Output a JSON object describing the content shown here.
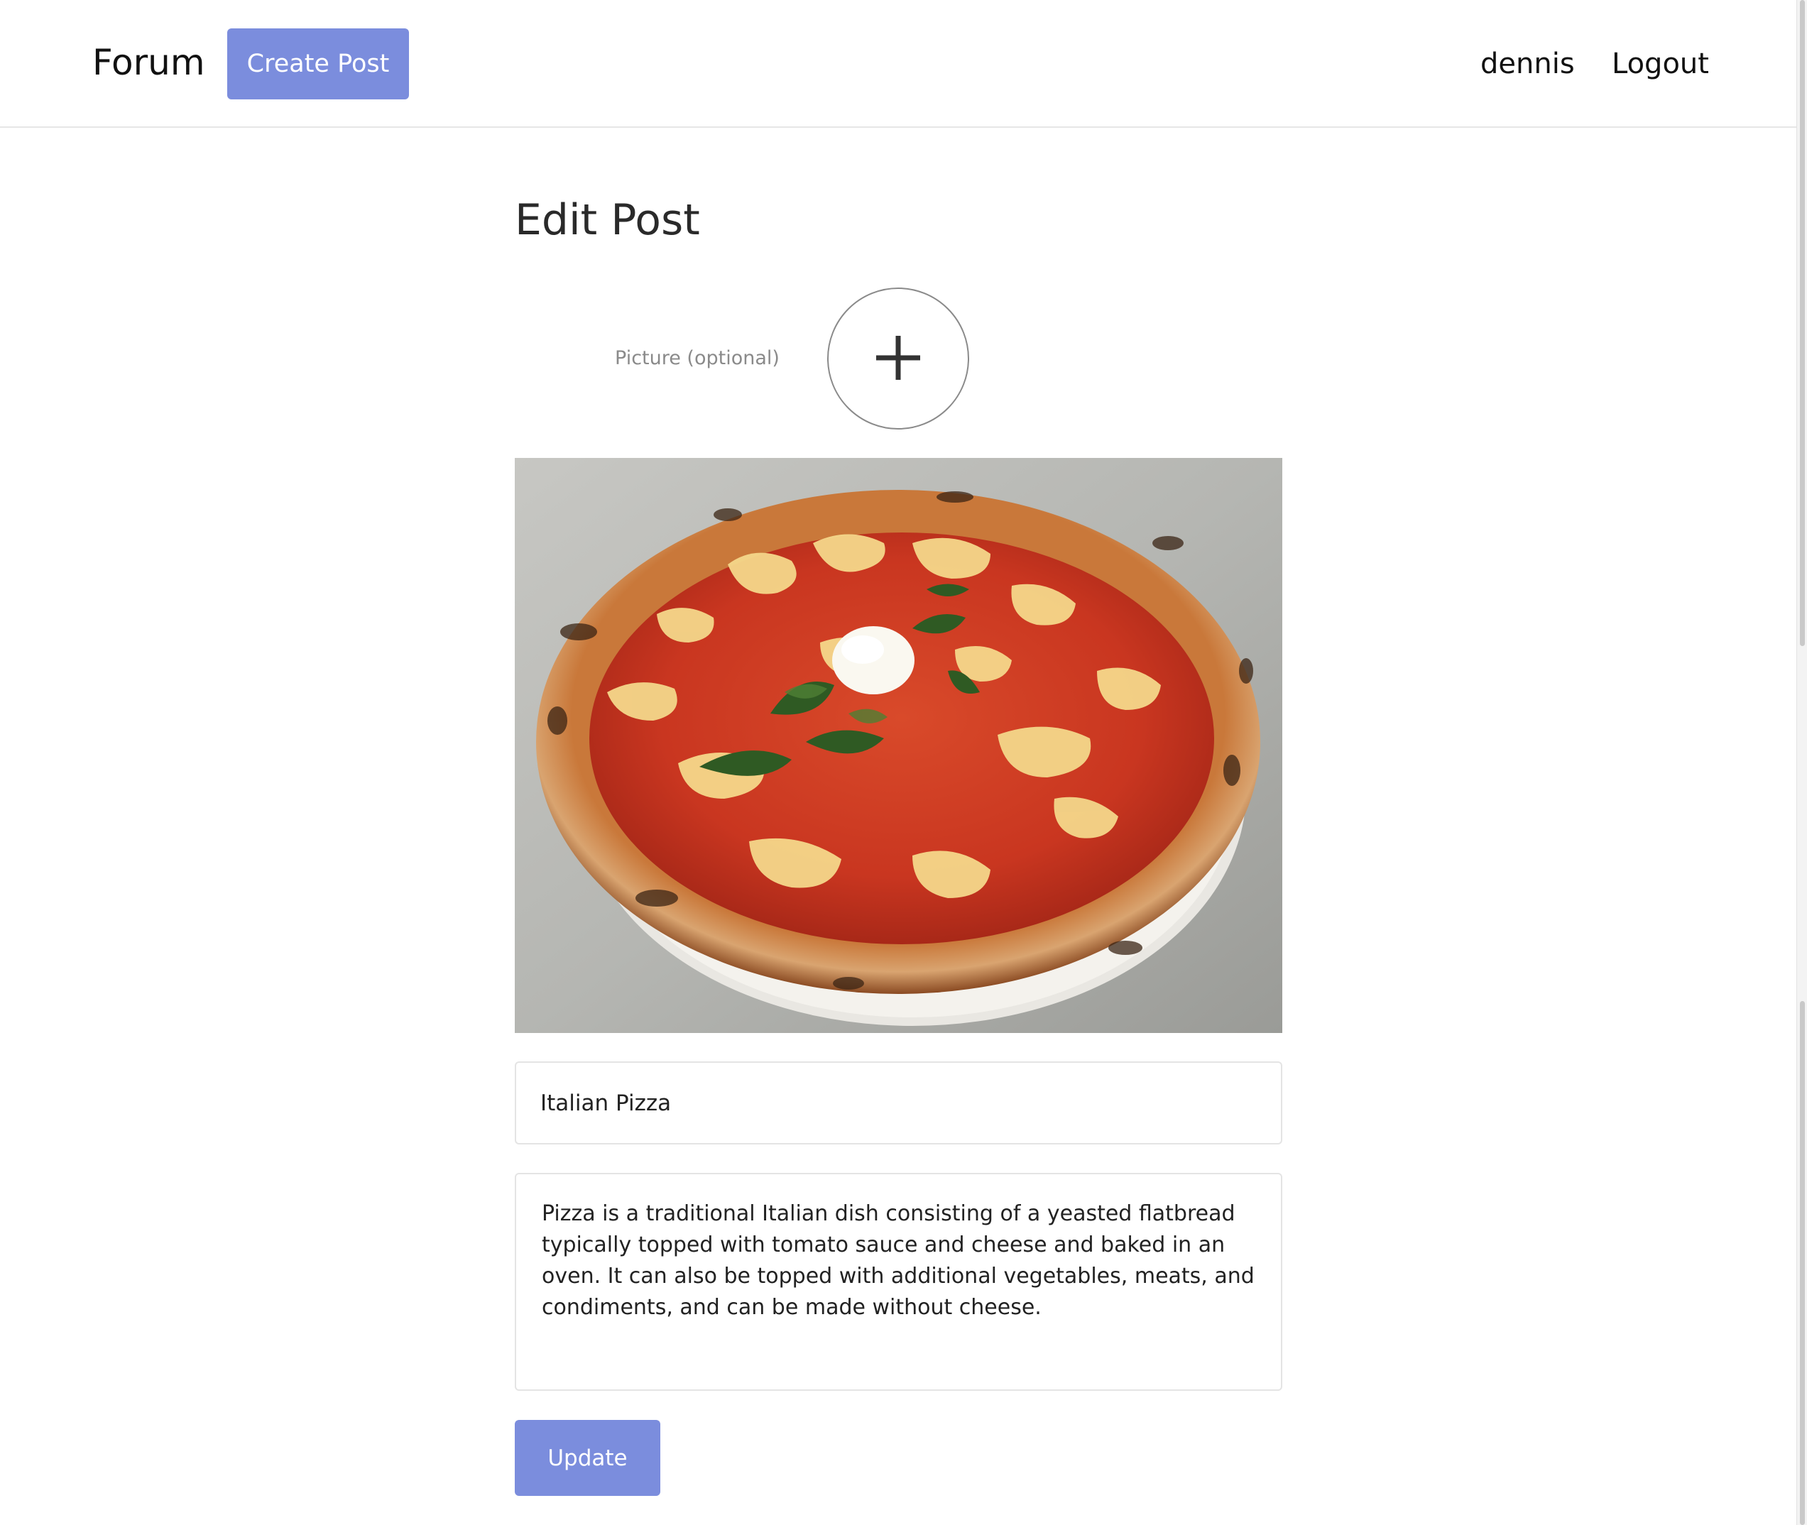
{
  "navbar": {
    "brand": "Forum",
    "create_post_label": "Create Post",
    "username": "dennis",
    "logout_label": "Logout",
    "accent_color": "#7b8ddd"
  },
  "form": {
    "heading": "Edit Post",
    "picture_label": "Picture (optional)",
    "picture_button_icon": "plus-icon",
    "image_subject": "pizza margherita photo",
    "title_value": "Italian Pizza",
    "body_value": "Pizza is a traditional Italian dish consisting of a yeasted flatbread typically topped with tomato sauce and cheese and baked in an oven. It can also be topped with additional vegetables, meats, and condiments, and can be made without cheese.",
    "submit_label": "Update"
  }
}
